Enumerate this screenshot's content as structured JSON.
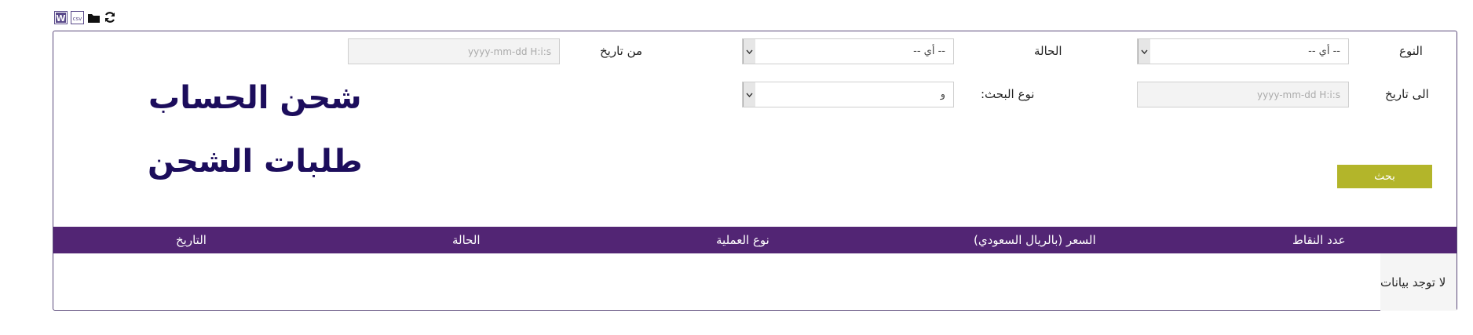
{
  "toolbar": {
    "icons": [
      "word-export-icon",
      "excel-export-icon",
      "folder-icon",
      "refresh-icon"
    ]
  },
  "filters": {
    "type_label": "النوع",
    "type_value": "-- أي --",
    "status_label": "الحالة",
    "status_value": "-- أي --",
    "from_date_label": "من تاريخ",
    "from_date_placeholder": "yyyy-mm-dd H:i:s",
    "to_date_label": "الى تاريخ",
    "to_date_placeholder": "yyyy-mm-dd H:i:s",
    "search_type_label": "نوع البحث:",
    "search_type_value": "و"
  },
  "titles": {
    "main": "شحن الحساب",
    "sub": "طلبات الشحن"
  },
  "search_button": "بحث",
  "table": {
    "headers": [
      "عدد النقاط",
      "السعر (بالريال السعودي)",
      "نوع العملية",
      "الحالة",
      "التاريخ"
    ],
    "empty_text": "لا توجد بيانات"
  },
  "colors": {
    "header_bg": "#522574",
    "title_color": "#1c0d5c",
    "button_bg": "#b3b52a"
  }
}
